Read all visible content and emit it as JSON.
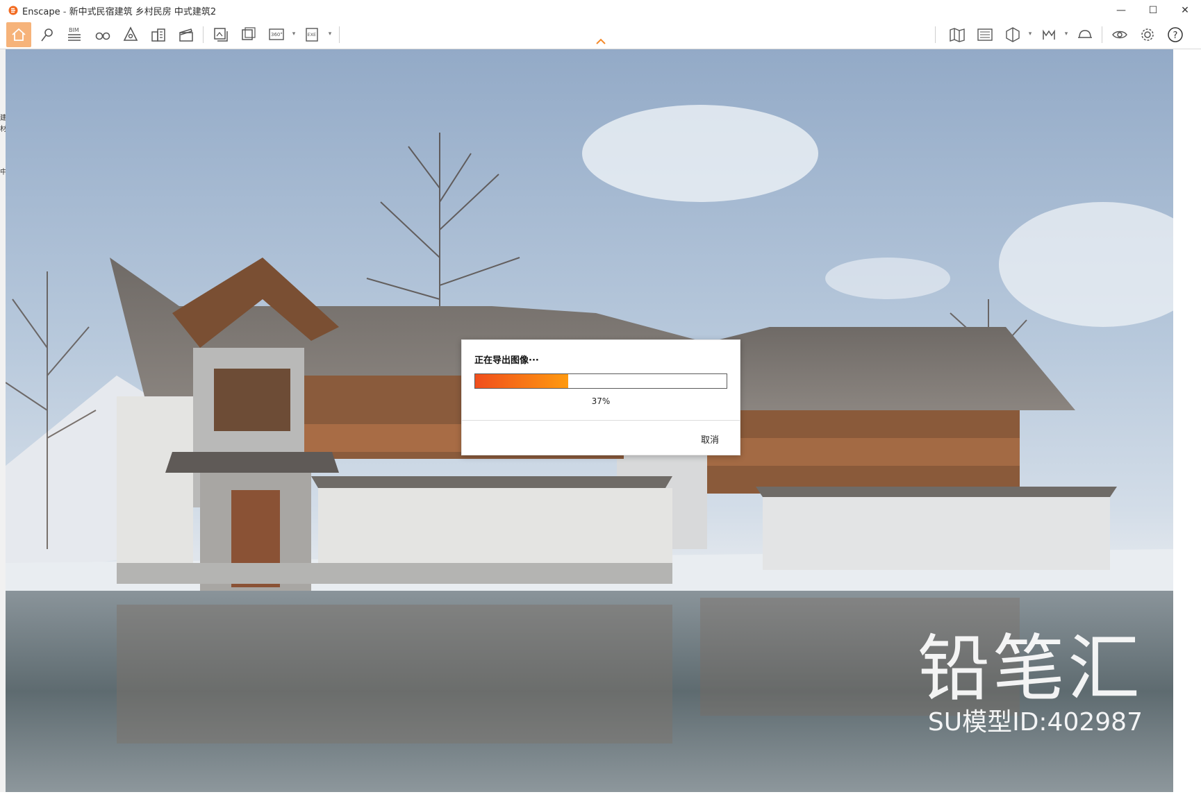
{
  "window": {
    "app_name": "Enscape",
    "title_separator": " - ",
    "document_title": "新中式民宿建筑 乡村民房 中式建筑2",
    "minimize_label": "—",
    "maximize_label": "☐",
    "close_label": "✕"
  },
  "toolbar": {
    "accent_color": "#f6b37a",
    "bim_label": "BIM",
    "pano_label": "360°",
    "exe_label": "EXE",
    "help_label": "?",
    "chevron_color": "#f58a2a"
  },
  "left_strip": {
    "chars": [
      "建",
      "材",
      "中"
    ]
  },
  "dialog": {
    "title": "正在导出图像···",
    "progress": 0.37,
    "progress_label": "37%",
    "cancel_label": "取消"
  },
  "watermark": {
    "brand": "铅笔汇",
    "model_id": "SU模型ID:402987"
  }
}
